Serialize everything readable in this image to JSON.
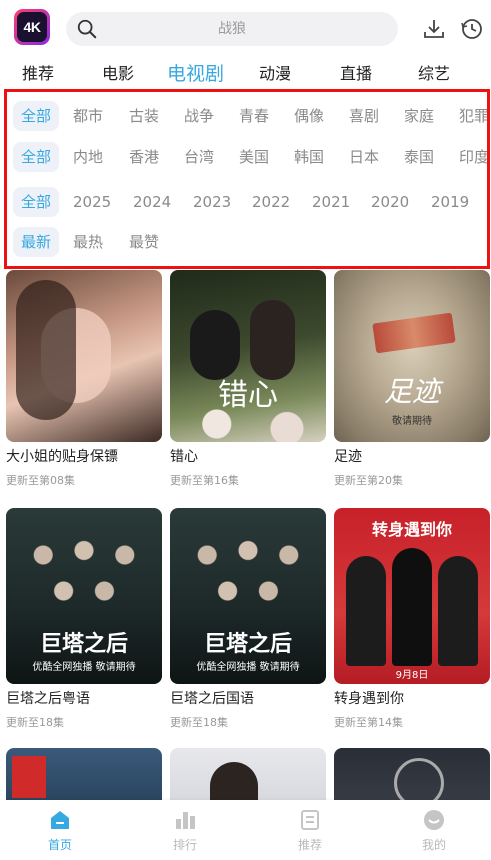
{
  "header": {
    "logo_text": "4K",
    "search_placeholder": "战狼"
  },
  "category_tabs": [
    {
      "label": "推荐",
      "active": false
    },
    {
      "label": "电影",
      "active": false
    },
    {
      "label": "电视剧",
      "active": true
    },
    {
      "label": "动漫",
      "active": false
    },
    {
      "label": "直播",
      "active": false
    },
    {
      "label": "综艺",
      "active": false
    }
  ],
  "filters": {
    "genre": [
      "全部",
      "都市",
      "古装",
      "战争",
      "青春",
      "偶像",
      "喜剧",
      "家庭",
      "犯罪"
    ],
    "region": [
      "全部",
      "内地",
      "香港",
      "台湾",
      "美国",
      "韩国",
      "日本",
      "泰国",
      "印度"
    ],
    "year": [
      "全部",
      "2025",
      "2024",
      "2023",
      "2022",
      "2021",
      "2020",
      "2019"
    ],
    "sort": [
      "最新",
      "最热",
      "最赞"
    ]
  },
  "cards": [
    {
      "title": "大小姐的贴身保镖",
      "subtitle": "更新至第08集",
      "poster_text": ""
    },
    {
      "title": "错心",
      "subtitle": "更新至第16集",
      "poster_text": "错心"
    },
    {
      "title": "足迹",
      "subtitle": "更新至第20集",
      "poster_text": "足迹",
      "poster_sub": "敬请期待"
    },
    {
      "title": "巨塔之后粤语",
      "subtitle": "更新至18集",
      "poster_text": "巨塔之后",
      "poster_sub": "优酷全网独播 敬请期待"
    },
    {
      "title": "巨塔之后国语",
      "subtitle": "更新至18集",
      "poster_text": "巨塔之后",
      "poster_sub": "优酷全网独播 敬请期待"
    },
    {
      "title": "转身遇到你",
      "subtitle": "更新至第14集",
      "poster_text": "转身遇到你",
      "poster_sub": "9月8日"
    },
    {
      "title": "",
      "subtitle": "",
      "poster_text": ""
    },
    {
      "title": "",
      "subtitle": "",
      "poster_text": ""
    },
    {
      "title": "",
      "subtitle": "",
      "poster_text": ""
    }
  ],
  "bottom_nav": [
    {
      "label": "首页",
      "icon": "home-icon",
      "active": true
    },
    {
      "label": "排行",
      "icon": "ranking-icon",
      "active": false
    },
    {
      "label": "推荐",
      "icon": "recommend-icon",
      "active": false
    },
    {
      "label": "我的",
      "icon": "profile-icon",
      "active": false
    }
  ],
  "colors": {
    "accent": "#36a9e1",
    "highlight_border": "#ee1111"
  }
}
